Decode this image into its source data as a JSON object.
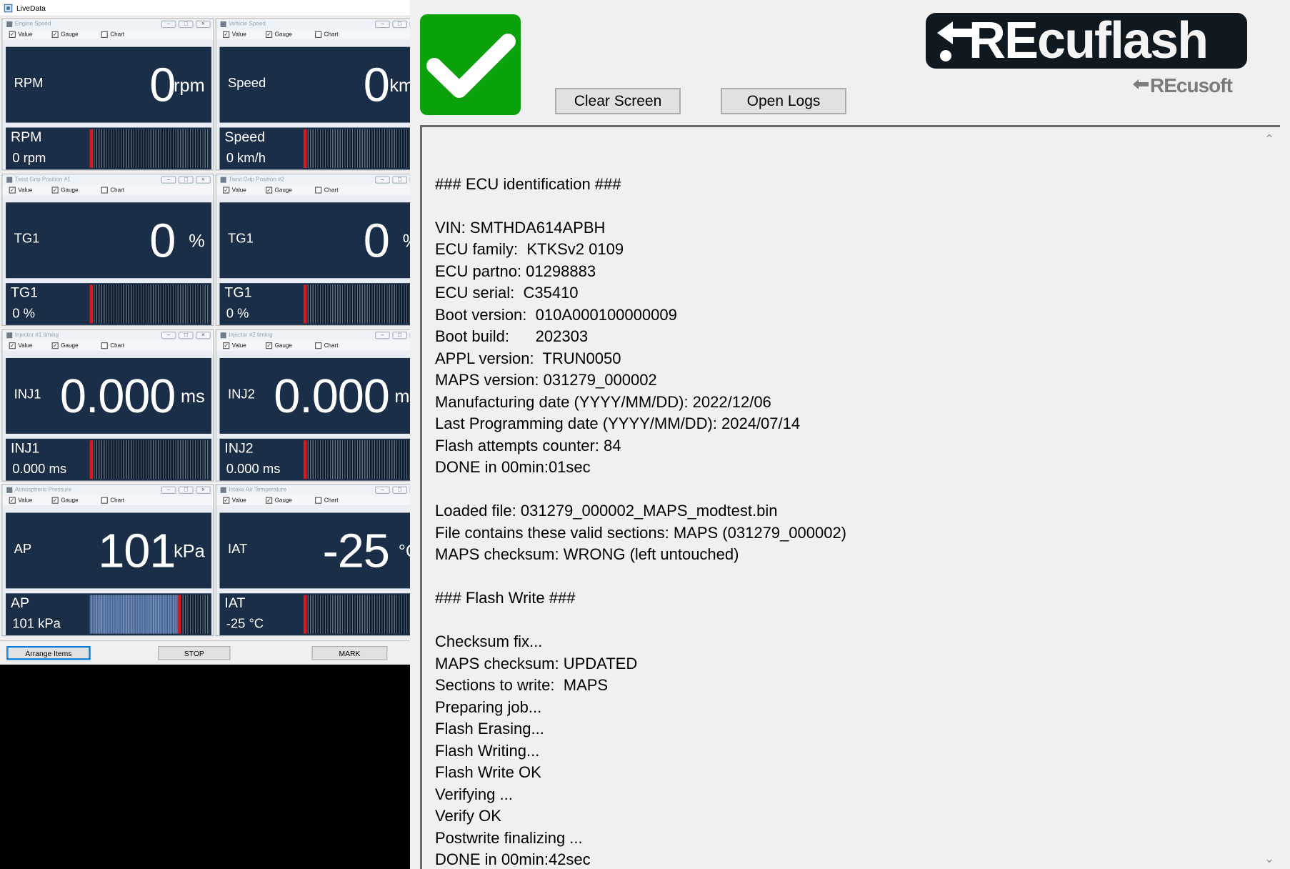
{
  "livedata": {
    "window_title": "LiveData",
    "option_labels": {
      "value": "Value",
      "gauge": "Gauge",
      "chart": "Chart"
    },
    "panels": [
      {
        "title": "Engine Speed",
        "label": "RPM",
        "value": "0",
        "unit": "rpm",
        "gauge_label": "RPM",
        "gauge_value": "0 rpm",
        "gauge_fill": 0
      },
      {
        "title": "Vehicle Speed",
        "label": "Speed",
        "value": "0",
        "unit": "km/",
        "gauge_label": "Speed",
        "gauge_value": "0 km/h",
        "gauge_fill": 0
      },
      {
        "title": "Twist Grip Position #1",
        "label": "TG1",
        "value": "0",
        "unit": "%",
        "gauge_label": "TG1",
        "gauge_value": "0  %",
        "gauge_fill": 0
      },
      {
        "title": "Twist Grip Position #2",
        "label": "TG1",
        "value": "0",
        "unit": "%",
        "gauge_label": "TG1",
        "gauge_value": "0  %",
        "gauge_fill": 0
      },
      {
        "title": "Injector #1 timing",
        "label": "INJ1",
        "value": "0.000",
        "unit": "ms",
        "gauge_label": "INJ1",
        "gauge_value": "0.000 ms",
        "gauge_fill": 0
      },
      {
        "title": "Injector #2 timing",
        "label": "INJ2",
        "value": "0.000",
        "unit": "ms",
        "gauge_label": "INJ2",
        "gauge_value": "0.000 ms",
        "gauge_fill": 0
      },
      {
        "title": "Atmospheric Pressure",
        "label": "AP",
        "value": "101",
        "unit": "kPa",
        "gauge_label": "AP",
        "gauge_value": "101 kPa",
        "gauge_fill": 0.74
      },
      {
        "title": "Intake Air Temperature",
        "label": "IAT",
        "value": "-25",
        "unit": "°C",
        "gauge_label": "IAT",
        "gauge_value": "-25  °C",
        "gauge_fill": 0
      }
    ],
    "buttons": {
      "arrange": "Arrange Items",
      "stop": "STOP",
      "mark": "MARK"
    }
  },
  "recuflash": {
    "logo_text_re": "RE",
    "logo_text_rest": "cuflash",
    "sublogo": "REcusoft",
    "status_icon": "check-icon",
    "status_color": "#0aa10a",
    "buttons": {
      "clear": "Clear Screen",
      "logs": "Open Logs"
    },
    "log_lines": [
      "",
      "### ECU identification ###",
      "",
      "VIN: SMTHDA614APBH",
      "ECU family:  KTKSv2 0109",
      "ECU partno: 01298883",
      "ECU serial:  C35410",
      "Boot version:  010A000100000009",
      "Boot build:      202303",
      "APPL version:  TRUN0050",
      "MAPS version: 031279_000002",
      "Manufacturing date (YYYY/MM/DD): 2022/12/06",
      "Last Programming date (YYYY/MM/DD): 2024/07/14",
      "Flash attempts counter: 84",
      "DONE in 00min:01sec",
      "",
      "Loaded file: 031279_000002_MAPS_modtest.bin",
      "File contains these valid sections: MAPS (031279_000002)",
      "MAPS checksum: WRONG (left untouched)",
      "",
      "### Flash Write ###",
      "",
      "Checksum fix...",
      "MAPS checksum: UPDATED",
      "Sections to write:  MAPS",
      "Preparing job...",
      "Flash Erasing...",
      "Flash Writing...",
      "Flash Write OK",
      "Verifying ...",
      "Verify OK",
      "Postwrite finalizing ...",
      "DONE in 00min:42sec"
    ]
  }
}
